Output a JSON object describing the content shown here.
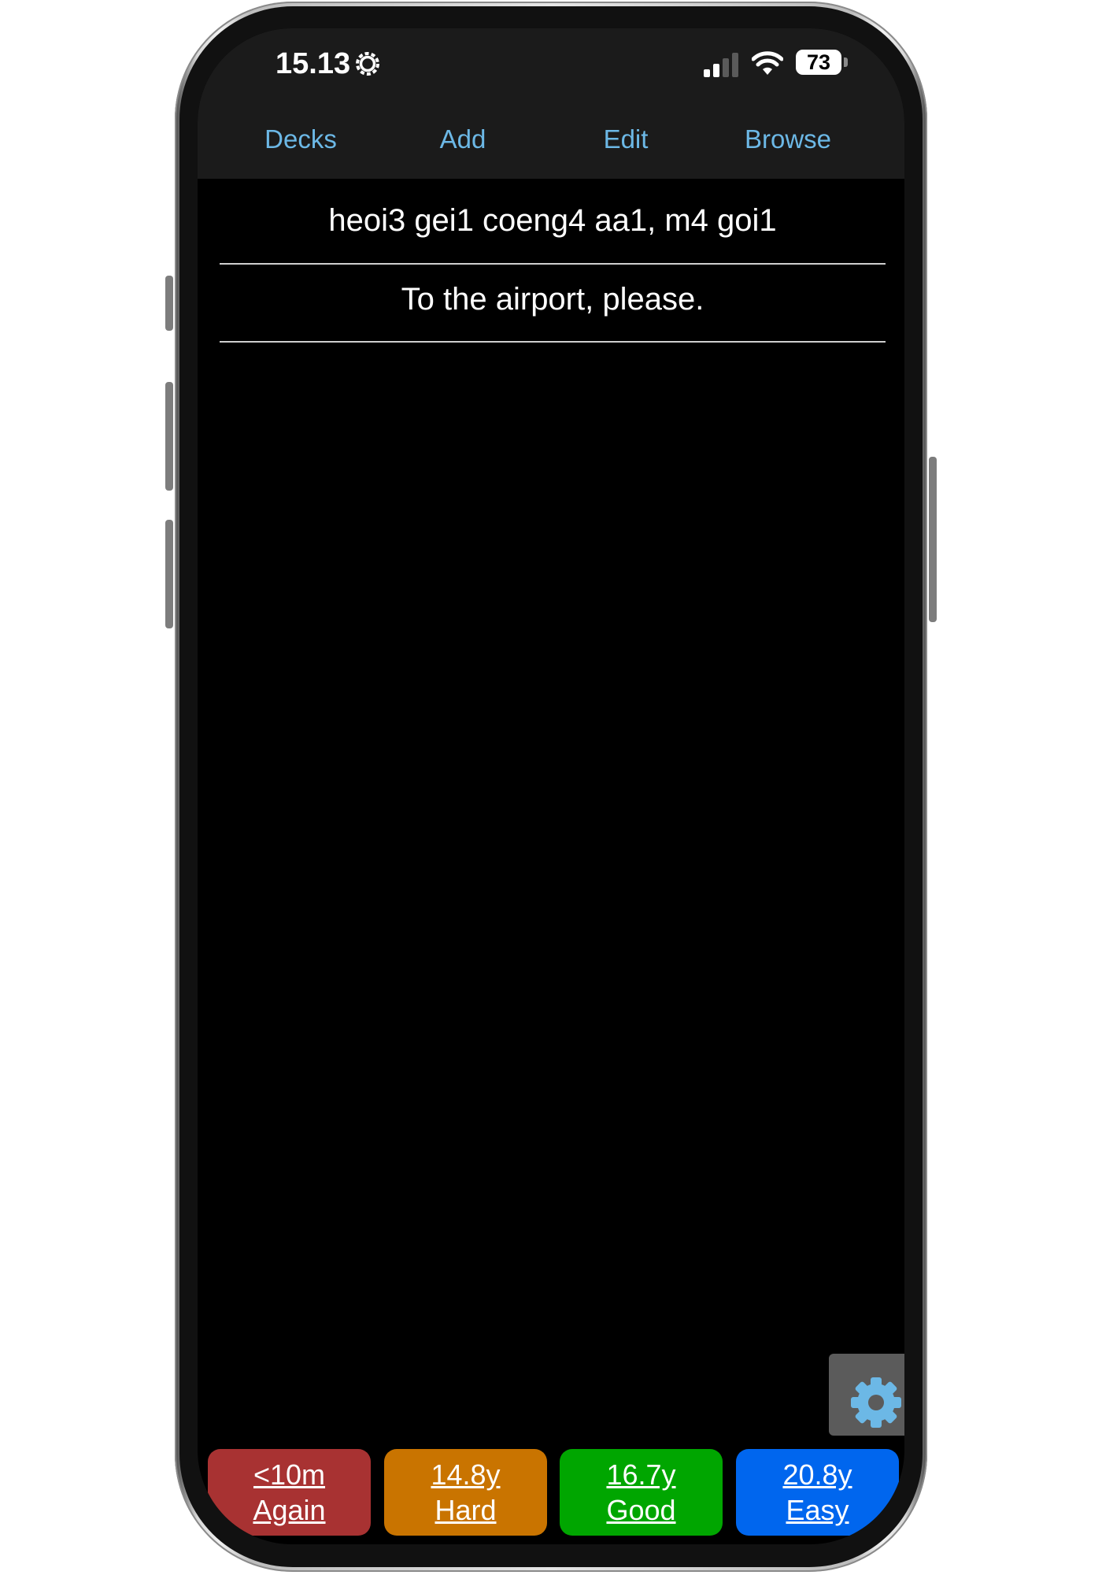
{
  "status_bar": {
    "time": "15.13",
    "battery_level": "73",
    "icons": [
      "settings-gear-icon",
      "cellular-signal-icon",
      "wifi-icon",
      "battery-icon"
    ]
  },
  "nav": {
    "decks": "Decks",
    "add": "Add",
    "edit": "Edit",
    "browse": "Browse",
    "color": "#6cb8e6"
  },
  "card": {
    "front": "heoi3 gei1 coeng4 aa1, m4 goi1",
    "back": "To the airport, please."
  },
  "answer_buttons": [
    {
      "interval": "<10m",
      "label": "Again",
      "color": "#a83232"
    },
    {
      "interval": "14.8y",
      "label": "Hard",
      "color": "#c97400"
    },
    {
      "interval": "16.7y",
      "label": "Good",
      "color": "#00a600"
    },
    {
      "interval": "20.8y",
      "label": "Easy",
      "color": "#0066ee"
    }
  ],
  "settings_button": {
    "icon": "gear-icon",
    "icon_color": "#6cb8e6"
  }
}
